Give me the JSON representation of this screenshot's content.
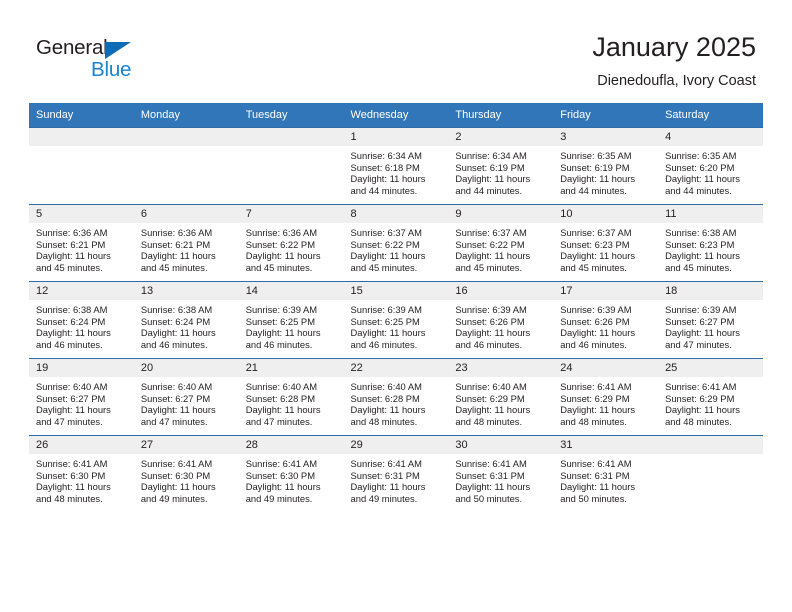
{
  "brand": {
    "name_top": "General",
    "name_bottom": "Blue",
    "triangle_color": "#0d6cb5",
    "blue_color": "#1b84d1"
  },
  "header": {
    "title": "January 2025",
    "subtitle": "Dienedoufla, Ivory Coast"
  },
  "theme": {
    "header_row_bg": "#3076b8",
    "header_row_text": "#ffffff",
    "daynum_bar_bg": "#efefef",
    "row_border": "#2d6ca8",
    "text": "#231f20"
  },
  "weekdays": [
    "Sunday",
    "Monday",
    "Tuesday",
    "Wednesday",
    "Thursday",
    "Friday",
    "Saturday"
  ],
  "weeks": [
    [
      {
        "day": "",
        "empty": true,
        "sunrise": "",
        "sunset": "",
        "daylight_line1": "",
        "daylight_line2": ""
      },
      {
        "day": "",
        "empty": true,
        "sunrise": "",
        "sunset": "",
        "daylight_line1": "",
        "daylight_line2": ""
      },
      {
        "day": "",
        "empty": true,
        "sunrise": "",
        "sunset": "",
        "daylight_line1": "",
        "daylight_line2": ""
      },
      {
        "day": "1",
        "empty": false,
        "sunrise": "Sunrise: 6:34 AM",
        "sunset": "Sunset: 6:18 PM",
        "daylight_line1": "Daylight: 11 hours",
        "daylight_line2": "and 44 minutes."
      },
      {
        "day": "2",
        "empty": false,
        "sunrise": "Sunrise: 6:34 AM",
        "sunset": "Sunset: 6:19 PM",
        "daylight_line1": "Daylight: 11 hours",
        "daylight_line2": "and 44 minutes."
      },
      {
        "day": "3",
        "empty": false,
        "sunrise": "Sunrise: 6:35 AM",
        "sunset": "Sunset: 6:19 PM",
        "daylight_line1": "Daylight: 11 hours",
        "daylight_line2": "and 44 minutes."
      },
      {
        "day": "4",
        "empty": false,
        "sunrise": "Sunrise: 6:35 AM",
        "sunset": "Sunset: 6:20 PM",
        "daylight_line1": "Daylight: 11 hours",
        "daylight_line2": "and 44 minutes."
      }
    ],
    [
      {
        "day": "5",
        "empty": false,
        "sunrise": "Sunrise: 6:36 AM",
        "sunset": "Sunset: 6:21 PM",
        "daylight_line1": "Daylight: 11 hours",
        "daylight_line2": "and 45 minutes."
      },
      {
        "day": "6",
        "empty": false,
        "sunrise": "Sunrise: 6:36 AM",
        "sunset": "Sunset: 6:21 PM",
        "daylight_line1": "Daylight: 11 hours",
        "daylight_line2": "and 45 minutes."
      },
      {
        "day": "7",
        "empty": false,
        "sunrise": "Sunrise: 6:36 AM",
        "sunset": "Sunset: 6:22 PM",
        "daylight_line1": "Daylight: 11 hours",
        "daylight_line2": "and 45 minutes."
      },
      {
        "day": "8",
        "empty": false,
        "sunrise": "Sunrise: 6:37 AM",
        "sunset": "Sunset: 6:22 PM",
        "daylight_line1": "Daylight: 11 hours",
        "daylight_line2": "and 45 minutes."
      },
      {
        "day": "9",
        "empty": false,
        "sunrise": "Sunrise: 6:37 AM",
        "sunset": "Sunset: 6:22 PM",
        "daylight_line1": "Daylight: 11 hours",
        "daylight_line2": "and 45 minutes."
      },
      {
        "day": "10",
        "empty": false,
        "sunrise": "Sunrise: 6:37 AM",
        "sunset": "Sunset: 6:23 PM",
        "daylight_line1": "Daylight: 11 hours",
        "daylight_line2": "and 45 minutes."
      },
      {
        "day": "11",
        "empty": false,
        "sunrise": "Sunrise: 6:38 AM",
        "sunset": "Sunset: 6:23 PM",
        "daylight_line1": "Daylight: 11 hours",
        "daylight_line2": "and 45 minutes."
      }
    ],
    [
      {
        "day": "12",
        "empty": false,
        "sunrise": "Sunrise: 6:38 AM",
        "sunset": "Sunset: 6:24 PM",
        "daylight_line1": "Daylight: 11 hours",
        "daylight_line2": "and 46 minutes."
      },
      {
        "day": "13",
        "empty": false,
        "sunrise": "Sunrise: 6:38 AM",
        "sunset": "Sunset: 6:24 PM",
        "daylight_line1": "Daylight: 11 hours",
        "daylight_line2": "and 46 minutes."
      },
      {
        "day": "14",
        "empty": false,
        "sunrise": "Sunrise: 6:39 AM",
        "sunset": "Sunset: 6:25 PM",
        "daylight_line1": "Daylight: 11 hours",
        "daylight_line2": "and 46 minutes."
      },
      {
        "day": "15",
        "empty": false,
        "sunrise": "Sunrise: 6:39 AM",
        "sunset": "Sunset: 6:25 PM",
        "daylight_line1": "Daylight: 11 hours",
        "daylight_line2": "and 46 minutes."
      },
      {
        "day": "16",
        "empty": false,
        "sunrise": "Sunrise: 6:39 AM",
        "sunset": "Sunset: 6:26 PM",
        "daylight_line1": "Daylight: 11 hours",
        "daylight_line2": "and 46 minutes."
      },
      {
        "day": "17",
        "empty": false,
        "sunrise": "Sunrise: 6:39 AM",
        "sunset": "Sunset: 6:26 PM",
        "daylight_line1": "Daylight: 11 hours",
        "daylight_line2": "and 46 minutes."
      },
      {
        "day": "18",
        "empty": false,
        "sunrise": "Sunrise: 6:39 AM",
        "sunset": "Sunset: 6:27 PM",
        "daylight_line1": "Daylight: 11 hours",
        "daylight_line2": "and 47 minutes."
      }
    ],
    [
      {
        "day": "19",
        "empty": false,
        "sunrise": "Sunrise: 6:40 AM",
        "sunset": "Sunset: 6:27 PM",
        "daylight_line1": "Daylight: 11 hours",
        "daylight_line2": "and 47 minutes."
      },
      {
        "day": "20",
        "empty": false,
        "sunrise": "Sunrise: 6:40 AM",
        "sunset": "Sunset: 6:27 PM",
        "daylight_line1": "Daylight: 11 hours",
        "daylight_line2": "and 47 minutes."
      },
      {
        "day": "21",
        "empty": false,
        "sunrise": "Sunrise: 6:40 AM",
        "sunset": "Sunset: 6:28 PM",
        "daylight_line1": "Daylight: 11 hours",
        "daylight_line2": "and 47 minutes."
      },
      {
        "day": "22",
        "empty": false,
        "sunrise": "Sunrise: 6:40 AM",
        "sunset": "Sunset: 6:28 PM",
        "daylight_line1": "Daylight: 11 hours",
        "daylight_line2": "and 48 minutes."
      },
      {
        "day": "23",
        "empty": false,
        "sunrise": "Sunrise: 6:40 AM",
        "sunset": "Sunset: 6:29 PM",
        "daylight_line1": "Daylight: 11 hours",
        "daylight_line2": "and 48 minutes."
      },
      {
        "day": "24",
        "empty": false,
        "sunrise": "Sunrise: 6:41 AM",
        "sunset": "Sunset: 6:29 PM",
        "daylight_line1": "Daylight: 11 hours",
        "daylight_line2": "and 48 minutes."
      },
      {
        "day": "25",
        "empty": false,
        "sunrise": "Sunrise: 6:41 AM",
        "sunset": "Sunset: 6:29 PM",
        "daylight_line1": "Daylight: 11 hours",
        "daylight_line2": "and 48 minutes."
      }
    ],
    [
      {
        "day": "26",
        "empty": false,
        "sunrise": "Sunrise: 6:41 AM",
        "sunset": "Sunset: 6:30 PM",
        "daylight_line1": "Daylight: 11 hours",
        "daylight_line2": "and 48 minutes."
      },
      {
        "day": "27",
        "empty": false,
        "sunrise": "Sunrise: 6:41 AM",
        "sunset": "Sunset: 6:30 PM",
        "daylight_line1": "Daylight: 11 hours",
        "daylight_line2": "and 49 minutes."
      },
      {
        "day": "28",
        "empty": false,
        "sunrise": "Sunrise: 6:41 AM",
        "sunset": "Sunset: 6:30 PM",
        "daylight_line1": "Daylight: 11 hours",
        "daylight_line2": "and 49 minutes."
      },
      {
        "day": "29",
        "empty": false,
        "sunrise": "Sunrise: 6:41 AM",
        "sunset": "Sunset: 6:31 PM",
        "daylight_line1": "Daylight: 11 hours",
        "daylight_line2": "and 49 minutes."
      },
      {
        "day": "30",
        "empty": false,
        "sunrise": "Sunrise: 6:41 AM",
        "sunset": "Sunset: 6:31 PM",
        "daylight_line1": "Daylight: 11 hours",
        "daylight_line2": "and 50 minutes."
      },
      {
        "day": "31",
        "empty": false,
        "sunrise": "Sunrise: 6:41 AM",
        "sunset": "Sunset: 6:31 PM",
        "daylight_line1": "Daylight: 11 hours",
        "daylight_line2": "and 50 minutes."
      },
      {
        "day": "",
        "empty": true,
        "sunrise": "",
        "sunset": "",
        "daylight_line1": "",
        "daylight_line2": ""
      }
    ]
  ]
}
